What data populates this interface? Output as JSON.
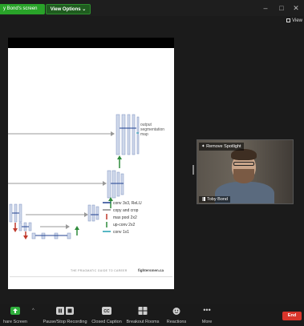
{
  "titlebar": {
    "share_label": "y Bond's screen",
    "view_options": "View Options ⌄",
    "minimize": "–",
    "restore": "□",
    "close": "✕",
    "view": "View"
  },
  "slide": {
    "output_label_1": "output",
    "output_label_2": "segmentation",
    "output_label_3": "map",
    "legend": [
      {
        "text": "conv 3x3, ReLU",
        "color": "#1f3f8f"
      },
      {
        "text": "copy and crop",
        "color": "#888888"
      },
      {
        "text": "max pool 2x2",
        "color": "#c0392b"
      },
      {
        "text": "up-conv 2x2",
        "color": "#2e8b3a"
      },
      {
        "text": "conv 1x1",
        "color": "#1f9fb0"
      }
    ],
    "footer": "THE PRAGMATIC GUIDE TO CAREER",
    "footer_brand": "fightersmen.ca"
  },
  "video": {
    "remove_spotlight": "Remove Spotlight",
    "name": "Toby Bond"
  },
  "toolbar": {
    "items": [
      {
        "label": "hare Screen",
        "icon": "share-screen-icon",
        "color": "#2fae3c"
      },
      {
        "label": "Pause/Stop Recording",
        "icon": "recording-icon",
        "color": "#cfcfcf"
      },
      {
        "label": "Closed Caption",
        "icon": "cc-icon",
        "color": "#cfcfcf"
      },
      {
        "label": "Breakout Rooms",
        "icon": "breakout-rooms-icon",
        "color": "#cfcfcf"
      },
      {
        "label": "Reactions",
        "icon": "reactions-icon",
        "color": "#cfcfcf"
      },
      {
        "label": "More",
        "icon": "more-icon",
        "color": "#cfcfcf"
      }
    ],
    "end_label": "End"
  }
}
